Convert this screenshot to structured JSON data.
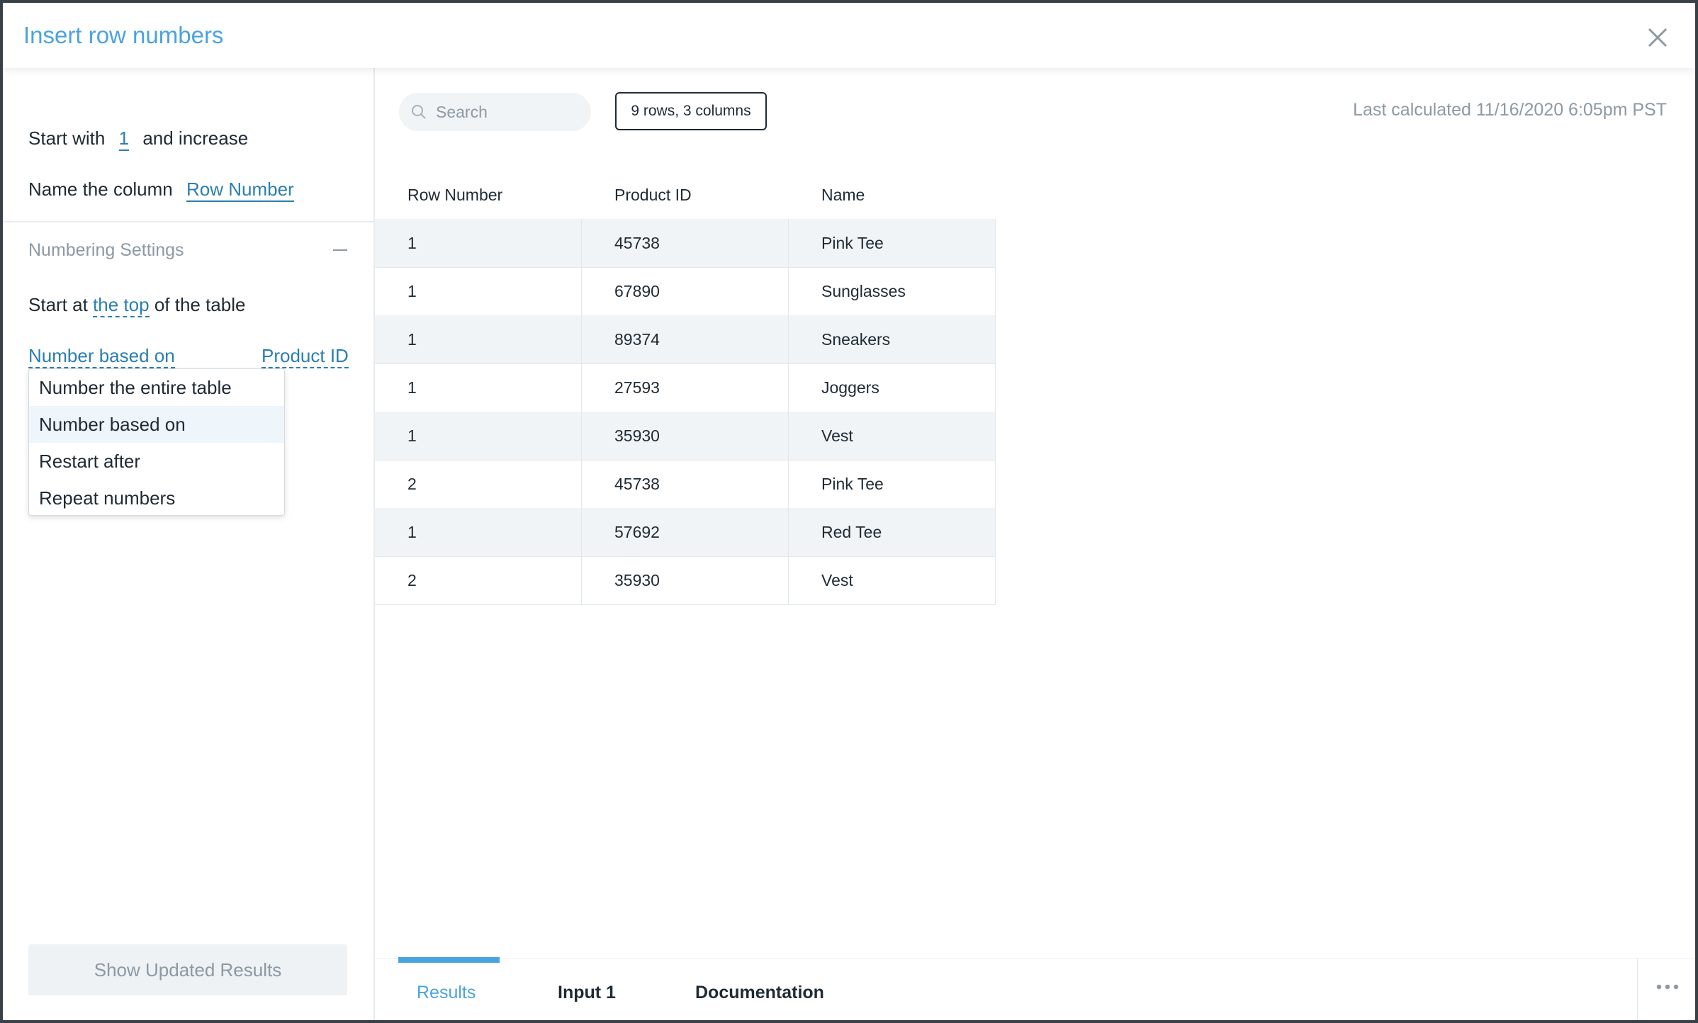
{
  "header": {
    "title": "Insert row numbers",
    "close_icon": "close-icon"
  },
  "left": {
    "start_prefix": "Start with",
    "start_value": "1",
    "start_suffix": "and increase",
    "name_prefix": "Name the column",
    "name_value": "Row Number",
    "settings_title": "Numbering Settings",
    "start_at_prefix": "Start at",
    "start_at_value": "the top",
    "start_at_suffix": "of the table",
    "number_mode": "Number based on",
    "number_column": "Product ID",
    "dropdown": {
      "items": [
        {
          "label": "Number the entire table"
        },
        {
          "label": "Number based on",
          "selected": true
        },
        {
          "label": "Restart after"
        },
        {
          "label": "Repeat numbers"
        }
      ]
    },
    "show_button": "Show Updated Results"
  },
  "toolbar": {
    "search_placeholder": "Search",
    "row_count": "9 rows, 3 columns",
    "last_calculated": "Last calculated 11/16/2020 6:05pm PST"
  },
  "table": {
    "columns": [
      "Row Number",
      "Product ID",
      "Name"
    ],
    "rows": [
      [
        "1",
        "45738",
        "Pink Tee"
      ],
      [
        "1",
        "67890",
        "Sunglasses"
      ],
      [
        "1",
        "89374",
        "Sneakers"
      ],
      [
        "1",
        "27593",
        "Joggers"
      ],
      [
        "1",
        "35930",
        "Vest"
      ],
      [
        "2",
        "45738",
        "Pink Tee"
      ],
      [
        "1",
        "57692",
        "Red Tee"
      ],
      [
        "2",
        "35930",
        "Vest"
      ]
    ]
  },
  "tabs": [
    {
      "label": "Results",
      "active": true
    },
    {
      "label": "Input 1"
    },
    {
      "label": "Documentation"
    }
  ],
  "colors": {
    "accent": "#4aa3df",
    "link": "#2a7fb0",
    "muted": "#8d99a3"
  }
}
